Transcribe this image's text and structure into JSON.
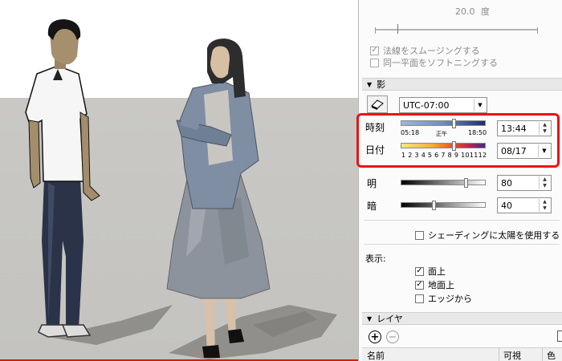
{
  "panel": {
    "angle": {
      "value": "20.0",
      "unit": "度"
    },
    "edges": {
      "smooth_normals_label": "法線をスムージングする",
      "soften_coplanar_label": "同一平面をソフトニングする"
    },
    "shadows": {
      "header": "影",
      "timezone": "UTC-07:00",
      "time_label": "時刻",
      "time_start": "05:18",
      "time_noon": "正午",
      "time_end": "18:50",
      "time_value": "13:44",
      "date_label": "日付",
      "months": "1 2 3 4 5 6 7 8 9 101112",
      "date_value": "08/17",
      "light_label": "明",
      "light_value": "80",
      "dark_label": "暗",
      "dark_value": "40",
      "use_sun_label": "シェーディングに太陽を使用する",
      "display_label": "表示:",
      "on_faces_label": "面上",
      "on_ground_label": "地面上",
      "from_edges_label": "エッジから"
    },
    "layers": {
      "header": "レイヤ",
      "col_name": "名前",
      "col_visible": "可視",
      "col_color": "色"
    }
  },
  "colors": {
    "highlight": "#ee1111",
    "sky": "#ffffff",
    "ground": "#c6c5c1"
  }
}
